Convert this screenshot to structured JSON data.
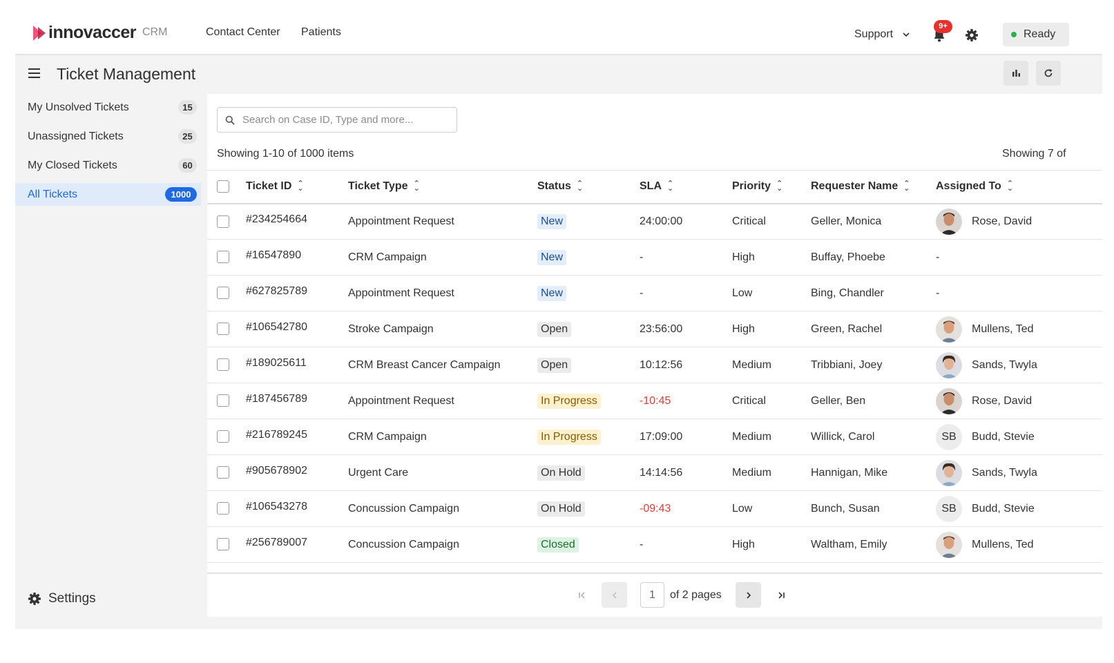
{
  "brand": {
    "name": "innovaccer",
    "product": "CRM"
  },
  "nav": [
    {
      "label": "Contact Center"
    },
    {
      "label": "Patients"
    }
  ],
  "topbar": {
    "support_label": "Support",
    "notification_count": "9+",
    "ready_label": "Ready"
  },
  "page": {
    "title": "Ticket Management"
  },
  "sidebar": {
    "items": [
      {
        "label": "My Unsolved Tickets",
        "count": "15"
      },
      {
        "label": "Unassigned Tickets",
        "count": "25"
      },
      {
        "label": "My Closed Tickets",
        "count": "60"
      },
      {
        "label": "All Tickets",
        "count": "1000",
        "active": true
      }
    ],
    "settings_label": "Settings"
  },
  "search": {
    "placeholder": "Search on Case ID, Type and more...",
    "value": ""
  },
  "summary": {
    "left": "Showing 1-10 of 1000 items",
    "right": "Showing 7 of"
  },
  "table": {
    "columns": [
      "Ticket ID",
      "Ticket Type",
      "Status",
      "SLA",
      "Priority",
      "Requester Name",
      "Assigned To"
    ],
    "rows": [
      {
        "id": "#234254664",
        "type": "Appointment Request",
        "status": "New",
        "sla": "24:00:00",
        "sla_overdue": false,
        "priority": "Critical",
        "requester": "Geller, Monica",
        "assignee": "Rose, David",
        "avatar": "david"
      },
      {
        "id": "#16547890",
        "type": "CRM Campaign",
        "status": "New",
        "sla": "-",
        "sla_overdue": false,
        "priority": "High",
        "requester": "Buffay, Phoebe",
        "assignee": "-",
        "avatar": ""
      },
      {
        "id": "#627825789",
        "type": "Appointment Request",
        "status": "New",
        "sla": "-",
        "sla_overdue": false,
        "priority": "Low",
        "requester": "Bing, Chandler",
        "assignee": "-",
        "avatar": ""
      },
      {
        "id": "#106542780",
        "type": "Stroke Campaign",
        "status": "Open",
        "sla": "23:56:00",
        "sla_overdue": false,
        "priority": "High",
        "requester": "Green, Rachel",
        "assignee": "Mullens, Ted",
        "avatar": "ted"
      },
      {
        "id": "#189025611",
        "type": "CRM Breast Cancer Campaign",
        "status": "Open",
        "sla": "10:12:56",
        "sla_overdue": false,
        "priority": "Medium",
        "requester": "Tribbiani, Joey",
        "assignee": "Sands, Twyla",
        "avatar": "twyla"
      },
      {
        "id": "#187456789",
        "type": "Appointment Request",
        "status": "In Progress",
        "sla": "-10:45",
        "sla_overdue": true,
        "priority": "Critical",
        "requester": "Geller, Ben",
        "assignee": "Rose, David",
        "avatar": "david"
      },
      {
        "id": "#216789245",
        "type": "CRM Campaign",
        "status": "In Progress",
        "sla": "17:09:00",
        "sla_overdue": false,
        "priority": "Medium",
        "requester": "Willick, Carol",
        "assignee": "Budd, Stevie",
        "avatar": "initials",
        "initials": "SB"
      },
      {
        "id": "#905678902",
        "type": "Urgent Care",
        "status": "On Hold",
        "sla": "14:14:56",
        "sla_overdue": false,
        "priority": "Medium",
        "requester": "Hannigan, Mike",
        "assignee": "Sands, Twyla",
        "avatar": "twyla"
      },
      {
        "id": "#106543278",
        "type": "Concussion Campaign",
        "status": "On Hold",
        "sla": "-09:43",
        "sla_overdue": true,
        "priority": "Low",
        "requester": "Bunch, Susan",
        "assignee": "Budd, Stevie",
        "avatar": "initials",
        "initials": "SB"
      },
      {
        "id": "#256789007",
        "type": "Concussion Campaign",
        "status": "Closed",
        "sla": "-",
        "sla_overdue": false,
        "priority": "High",
        "requester": "Waltham, Emily",
        "assignee": "Mullens, Ted",
        "avatar": "ted"
      }
    ]
  },
  "pagination": {
    "current_page": "1",
    "of_label": "of 2 pages"
  },
  "colors": {
    "accent": "#1f6ae2",
    "overdue": "#e23b36",
    "notification": "#e8302c",
    "ready": "#2bb24c"
  },
  "icons": [
    "hamburger-icon",
    "chart-icon",
    "refresh-icon",
    "search-icon",
    "bell-icon",
    "gear-icon",
    "chevron-down-icon",
    "first-page-icon",
    "prev-page-icon",
    "next-page-icon",
    "last-page-icon"
  ]
}
